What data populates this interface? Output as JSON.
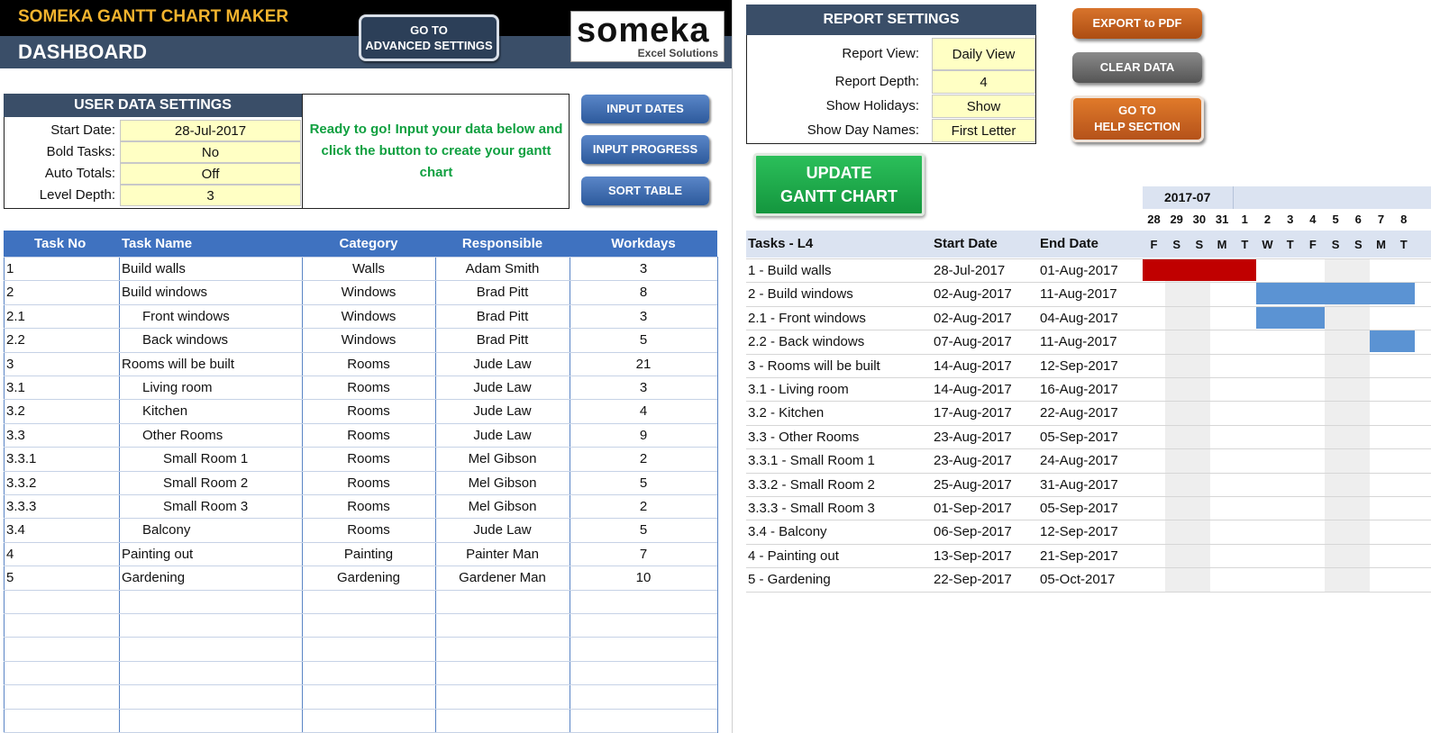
{
  "header": {
    "app_title": "SOMEKA GANTT CHART MAKER",
    "dashboard_title": "DASHBOARD",
    "advanced_button": [
      "GO TO",
      "ADVANCED SETTINGS"
    ],
    "logo_text": "someka",
    "logo_subtext": "Excel Solutions"
  },
  "user_settings": {
    "title": "USER DATA SETTINGS",
    "rows": [
      {
        "label": "Start Date:",
        "value": "28-Jul-2017"
      },
      {
        "label": "Bold Tasks:",
        "value": "No"
      },
      {
        "label": "Auto Totals:",
        "value": "Off"
      },
      {
        "label": "Level Depth:",
        "value": "3"
      }
    ],
    "ready_message": "Ready to go! Input your data below and click the button to create your gantt chart"
  },
  "buttons": {
    "input_dates": "INPUT DATES",
    "input_progress": "INPUT PROGRESS",
    "sort_table": "SORT TABLE",
    "export_pdf": "EXPORT to PDF",
    "clear_data": "CLEAR DATA",
    "help": [
      "GO TO",
      "HELP SECTION"
    ],
    "update": [
      "UPDATE",
      "GANTT CHART"
    ]
  },
  "report_settings": {
    "title": "REPORT SETTINGS",
    "rows": [
      {
        "label": "Report View:",
        "value": "Daily View"
      },
      {
        "label": "Report Depth:",
        "value": "4"
      },
      {
        "label": "Show Holidays:",
        "value": "Show"
      },
      {
        "label": "Show Day Names:",
        "value": "First Letter"
      }
    ]
  },
  "task_table": {
    "headers": [
      "Task No",
      "Task Name",
      "Category",
      "Responsible",
      "Workdays"
    ],
    "rows": [
      {
        "no": "1",
        "name": "Build walls",
        "level": 1,
        "category": "Walls",
        "responsible": "Adam Smith",
        "workdays": "3"
      },
      {
        "no": "2",
        "name": "Build windows",
        "level": 1,
        "category": "Windows",
        "responsible": "Brad Pitt",
        "workdays": "8"
      },
      {
        "no": "2.1",
        "name": "Front windows",
        "level": 2,
        "category": "Windows",
        "responsible": "Brad Pitt",
        "workdays": "3"
      },
      {
        "no": "2.2",
        "name": "Back windows",
        "level": 2,
        "category": "Windows",
        "responsible": "Brad Pitt",
        "workdays": "5"
      },
      {
        "no": "3",
        "name": "Rooms will be built",
        "level": 1,
        "category": "Rooms",
        "responsible": "Jude Law",
        "workdays": "21"
      },
      {
        "no": "3.1",
        "name": "Living room",
        "level": 2,
        "category": "Rooms",
        "responsible": "Jude Law",
        "workdays": "3"
      },
      {
        "no": "3.2",
        "name": "Kitchen",
        "level": 2,
        "category": "Rooms",
        "responsible": "Jude Law",
        "workdays": "4"
      },
      {
        "no": "3.3",
        "name": "Other Rooms",
        "level": 2,
        "category": "Rooms",
        "responsible": "Jude Law",
        "workdays": "9"
      },
      {
        "no": "3.3.1",
        "name": "Small Room 1",
        "level": 3,
        "category": "Rooms",
        "responsible": "Mel Gibson",
        "workdays": "2"
      },
      {
        "no": "3.3.2",
        "name": "Small Room 2",
        "level": 3,
        "category": "Rooms",
        "responsible": "Mel Gibson",
        "workdays": "5"
      },
      {
        "no": "3.3.3",
        "name": "Small Room 3",
        "level": 3,
        "category": "Rooms",
        "responsible": "Mel Gibson",
        "workdays": "2"
      },
      {
        "no": "3.4",
        "name": "Balcony",
        "level": 2,
        "category": "Rooms",
        "responsible": "Jude Law",
        "workdays": "5"
      },
      {
        "no": "4",
        "name": "Painting out",
        "level": 1,
        "category": "Painting",
        "responsible": "Painter Man",
        "workdays": "7"
      },
      {
        "no": "5",
        "name": "Gardening",
        "level": 1,
        "category": "Gardening",
        "responsible": "Gardener Man",
        "workdays": "10"
      }
    ]
  },
  "gantt": {
    "headers": {
      "tasks": "Tasks - L4",
      "start": "Start Date",
      "end": "End Date"
    },
    "month_label": "2017-07",
    "days": [
      "28",
      "29",
      "30",
      "31",
      "1",
      "2",
      "3",
      "4",
      "5",
      "6",
      "7",
      "8"
    ],
    "day_letters": [
      "F",
      "S",
      "S",
      "M",
      "T",
      "W",
      "T",
      "F",
      "S",
      "S",
      "M",
      "T"
    ],
    "weekend_columns": [
      1,
      2,
      8,
      9
    ],
    "rows": [
      {
        "label": "1 - Build walls",
        "start": "28-Jul-2017",
        "end": "01-Aug-2017"
      },
      {
        "label": "2 - Build windows",
        "start": "02-Aug-2017",
        "end": "11-Aug-2017"
      },
      {
        "label": "2.1 - Front windows",
        "start": "02-Aug-2017",
        "end": "04-Aug-2017"
      },
      {
        "label": "2.2 - Back windows",
        "start": "07-Aug-2017",
        "end": "11-Aug-2017"
      },
      {
        "label": "3 - Rooms will be built",
        "start": "14-Aug-2017",
        "end": "12-Sep-2017"
      },
      {
        "label": "3.1 - Living room",
        "start": "14-Aug-2017",
        "end": "16-Aug-2017"
      },
      {
        "label": "3.2 - Kitchen",
        "start": "17-Aug-2017",
        "end": "22-Aug-2017"
      },
      {
        "label": "3.3 - Other Rooms",
        "start": "23-Aug-2017",
        "end": "05-Sep-2017"
      },
      {
        "label": "3.3.1 - Small Room 1",
        "start": "23-Aug-2017",
        "end": "24-Aug-2017"
      },
      {
        "label": "3.3.2 - Small Room 2",
        "start": "25-Aug-2017",
        "end": "31-Aug-2017"
      },
      {
        "label": "3.3.3 - Small Room 3",
        "start": "01-Sep-2017",
        "end": "05-Sep-2017"
      },
      {
        "label": "3.4 - Balcony",
        "start": "06-Sep-2017",
        "end": "12-Sep-2017"
      },
      {
        "label": "4 - Painting out",
        "start": "13-Sep-2017",
        "end": "21-Sep-2017"
      },
      {
        "label": "5 - Gardening",
        "start": "22-Sep-2017",
        "end": "05-Oct-2017"
      }
    ],
    "bars": [
      {
        "row": 0,
        "from_col": 0,
        "to_col": 4,
        "color": "#c00000"
      },
      {
        "row": 1,
        "from_col": 5,
        "to_col": 11,
        "color": "#5b93d3"
      },
      {
        "row": 2,
        "from_col": 5,
        "to_col": 7,
        "color": "#5b93d3"
      },
      {
        "row": 3,
        "from_col": 10,
        "to_col": 11,
        "color": "#5b93d3"
      }
    ]
  },
  "colors": {
    "header_navy": "#3a4e68",
    "title_gold": "#f2b32e",
    "table_header_blue": "#3f72c0",
    "input_yellow": "#ffffc4",
    "ready_green": "#10a040",
    "export_orange": "#c0571a",
    "clear_grey": "#6a6a6a",
    "update_green": "#1aa84a"
  }
}
